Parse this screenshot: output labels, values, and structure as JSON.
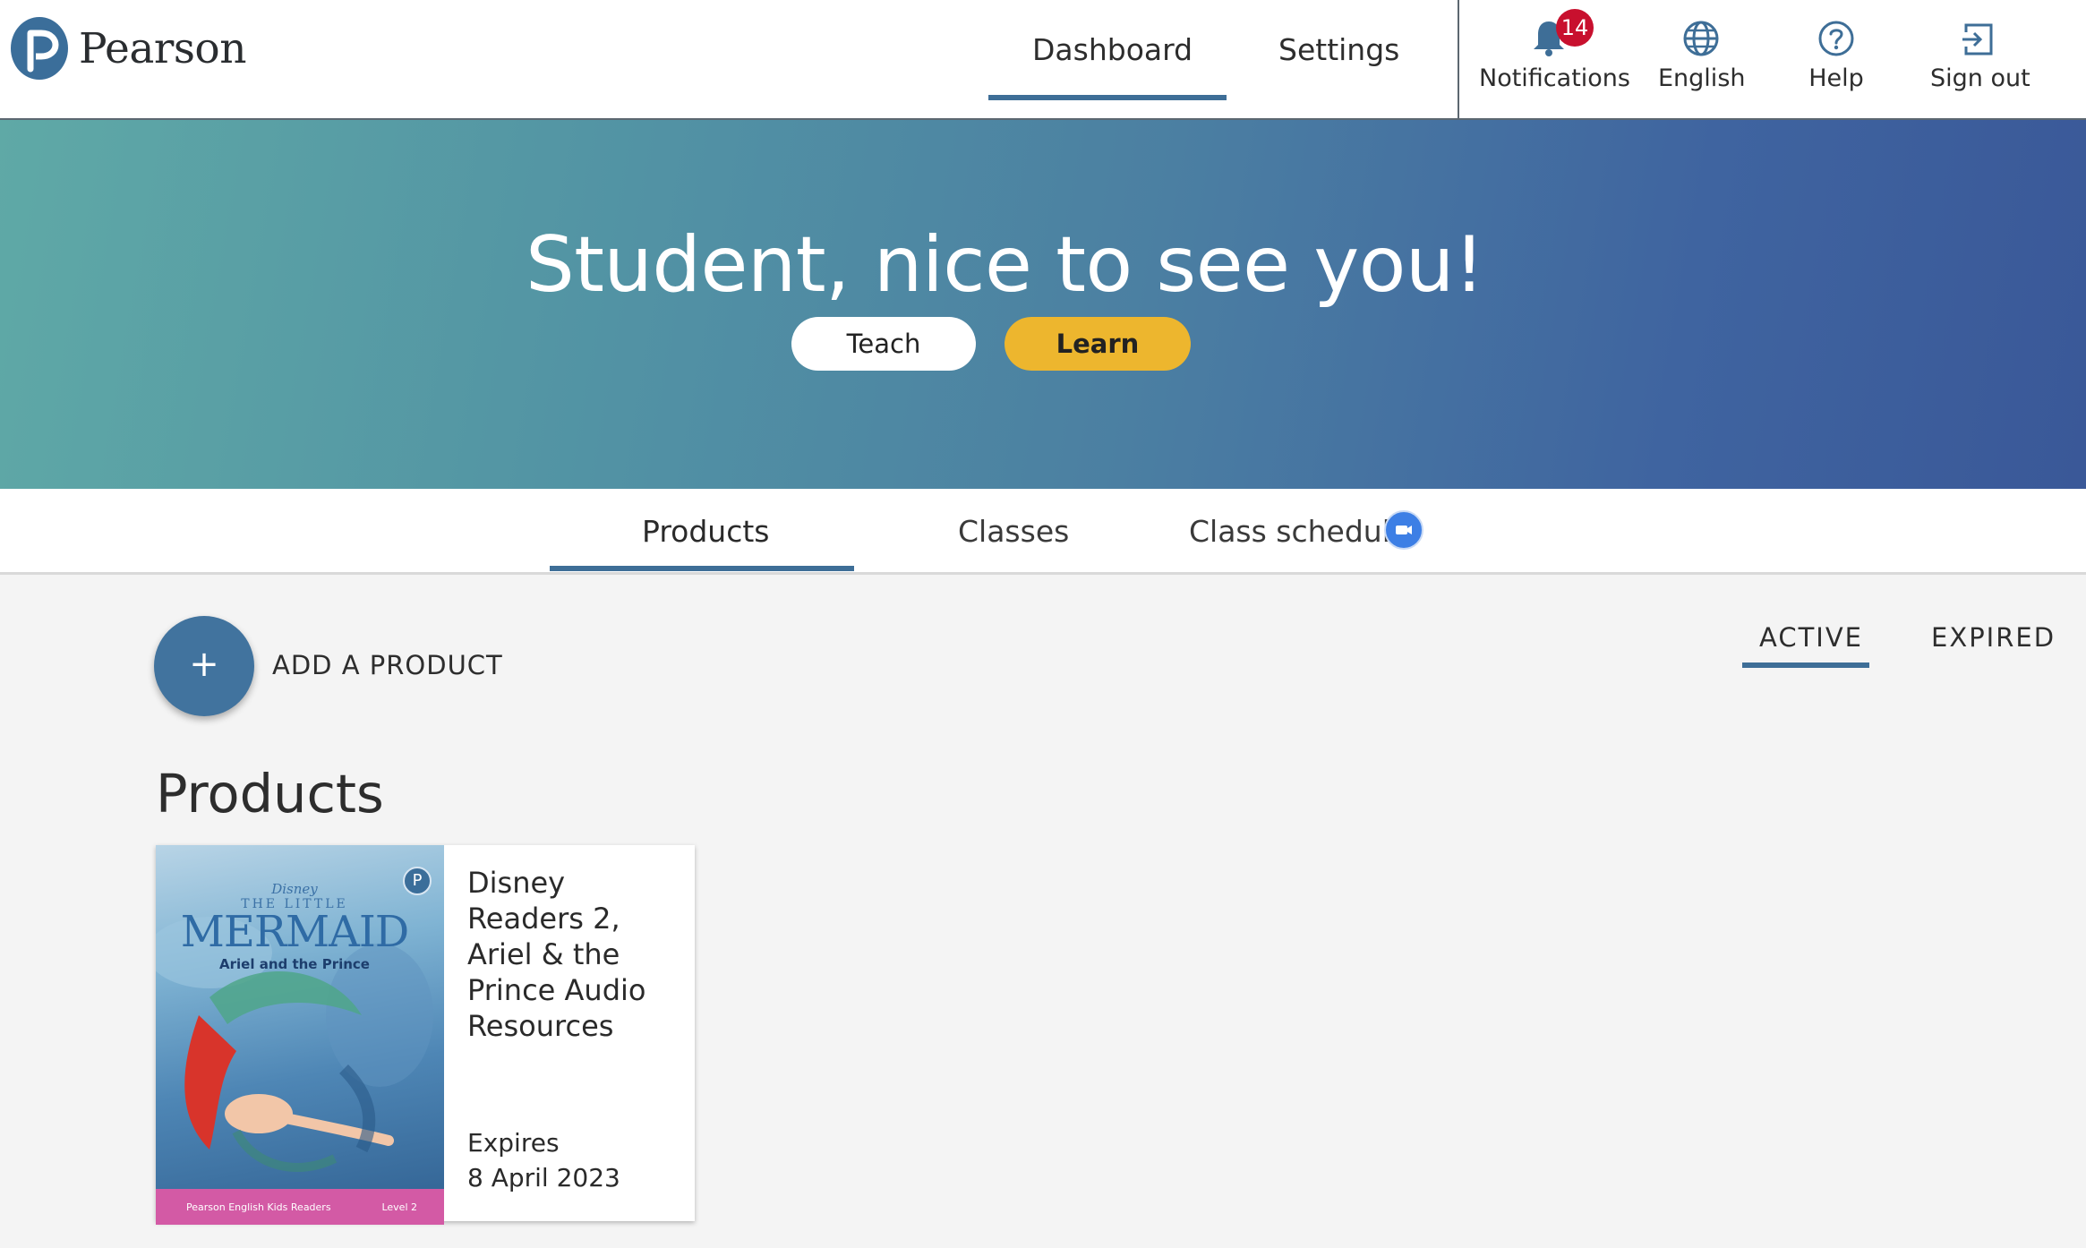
{
  "header": {
    "logo_text": "Pearson",
    "nav": [
      {
        "label": "Dashboard",
        "active": true
      },
      {
        "label": "Settings",
        "active": false
      }
    ],
    "utilities": {
      "notifications_label": "Notifications",
      "notifications_count": "14",
      "language_label": "English",
      "help_label": "Help",
      "signout_label": "Sign out"
    }
  },
  "hero": {
    "greeting": "Student, nice to see you!",
    "teach_label": "Teach",
    "learn_label": "Learn"
  },
  "subtabs": [
    {
      "label": "Products",
      "active": true
    },
    {
      "label": "Classes",
      "active": false
    },
    {
      "label": "Class schedule",
      "active": false
    }
  ],
  "content": {
    "add_icon": "+",
    "add_label": "ADD A PRODUCT",
    "filters": [
      {
        "label": "ACTIVE",
        "active": true
      },
      {
        "label": "EXPIRED",
        "active": false
      }
    ],
    "section_title": "Products",
    "products": [
      {
        "title": "Disney Readers 2, Ariel & the Prince Audio Resources",
        "expires_label": "Expires",
        "expires_date": "8 April 2023",
        "cover": {
          "brand": "Disney",
          "series_top": "THE LITTLE",
          "series_main": "MERMAID",
          "subtitle": "Ariel and the Prince",
          "band_left": "Pearson English Kids Readers",
          "band_right": "Level 2"
        }
      }
    ]
  },
  "colors": {
    "accent": "#3e6e97",
    "learn_button": "#edb62e",
    "badge": "#c8102e"
  }
}
